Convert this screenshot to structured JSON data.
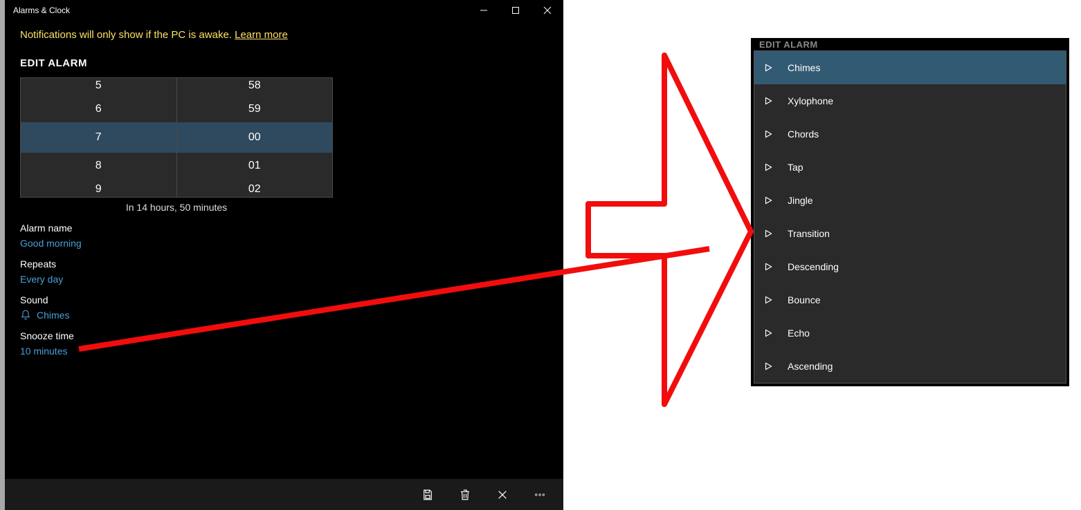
{
  "window": {
    "title": "Alarms & Clock"
  },
  "notice": {
    "text": "Notifications will only show if the PC is awake. ",
    "link": "Learn more"
  },
  "edit": {
    "heading": "EDIT ALARM",
    "hours": [
      "5",
      "6",
      "7",
      "8",
      "9"
    ],
    "minutes": [
      "58",
      "59",
      "00",
      "01",
      "02"
    ],
    "selected_index": 2,
    "hint": "In 14 hours, 50 minutes"
  },
  "fields": {
    "alarm_name_label": "Alarm name",
    "alarm_name_value": "Good morning",
    "repeats_label": "Repeats",
    "repeats_value": "Every day",
    "sound_label": "Sound",
    "sound_value": "Chimes",
    "snooze_label": "Snooze time",
    "snooze_value": "10 minutes"
  },
  "sound_popup": {
    "heading": "EDIT ALARM",
    "items": [
      "Chimes",
      "Xylophone",
      "Chords",
      "Tap",
      "Jingle",
      "Transition",
      "Descending",
      "Bounce",
      "Echo",
      "Ascending"
    ],
    "selected_index": 0
  }
}
